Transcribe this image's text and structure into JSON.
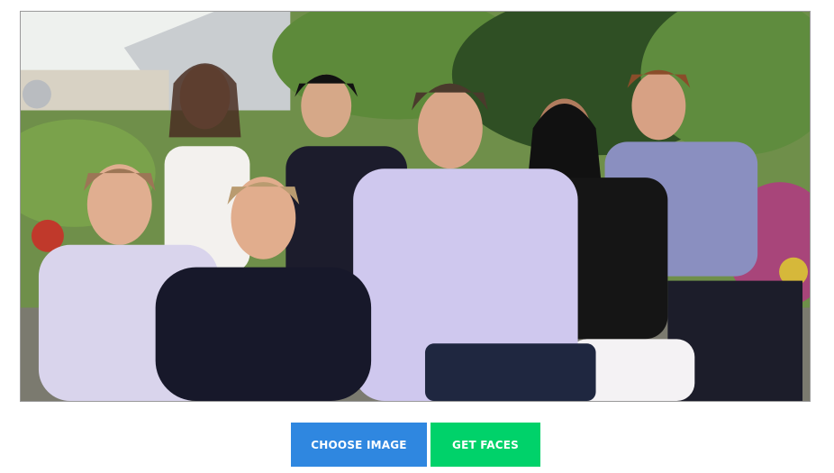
{
  "photo": {
    "icon": "group-photo-image",
    "people_visible": 7
  },
  "actions": {
    "choose_image_label": "CHOOSE IMAGE",
    "get_faces_label": "GET FACES",
    "choose_image_color": "#2f87e0",
    "get_faces_color": "#00d26a"
  }
}
